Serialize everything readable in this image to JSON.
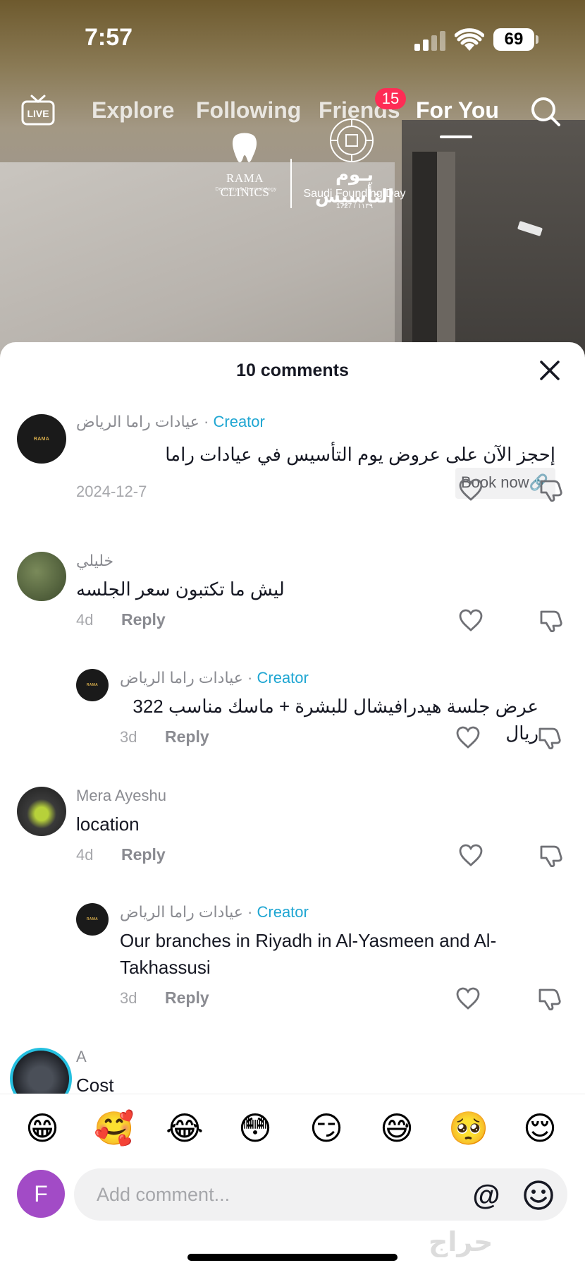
{
  "status_bar": {
    "time": "7:57",
    "battery": "69"
  },
  "top_nav": {
    "tabs": [
      {
        "label": "Explore"
      },
      {
        "label": "Following"
      },
      {
        "label": "Friends",
        "badge": "15"
      },
      {
        "label": "For You",
        "active": true
      }
    ],
    "live_label": "LIVE"
  },
  "video_overlay": {
    "clinic_name": "RAMA CLINICS",
    "clinic_sub": "Dentistry & Dermatology",
    "founding_ar": "يـوم التأسيس",
    "founding_en": "Saudi Founding Day",
    "founding_years": "1727 / ١١٣٩"
  },
  "comments_sheet": {
    "title": "10 comments",
    "comments": [
      {
        "author": "عيادات راما الرياض",
        "creator_label": "Creator",
        "body": "إحجز الآن على عروض يوم التأسيس في عيادات راما",
        "link_label": "Book now",
        "date": "2024-12-7"
      },
      {
        "author": "خليلي",
        "body": "ليش ما تكتبون سعر الجلسه",
        "age": "4d",
        "reply_label": "Reply"
      },
      {
        "author": "عيادات راما الرياض",
        "creator_label": "Creator",
        "body": "عرض جلسة هيدرافيشال للبشرة + ماسك مناسب 322 ريال",
        "age": "3d",
        "reply_label": "Reply"
      },
      {
        "author": "Mera Ayeshu",
        "body": "location",
        "age": "4d",
        "reply_label": "Reply"
      },
      {
        "author": "عيادات راما الرياض",
        "creator_label": "Creator",
        "body": "Our branches in Riyadh in Al-Yasmeen and Al-Takhassusi",
        "age": "3d",
        "reply_label": "Reply"
      },
      {
        "author": "A",
        "body": "Cost"
      }
    ]
  },
  "emoji_bar": [
    "😁",
    "🥰",
    "😂",
    "😳",
    "😏",
    "😅",
    "🥺",
    "😌"
  ],
  "input_bar": {
    "user_initial": "F",
    "placeholder": "Add comment...",
    "mention_symbol": "@"
  },
  "watermark": "حراج"
}
